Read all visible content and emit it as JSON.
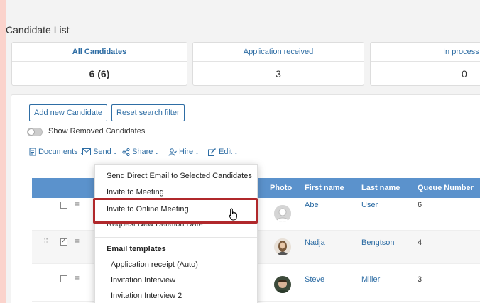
{
  "page": {
    "title": "Candidate List"
  },
  "stats": [
    {
      "label": "All Candidates",
      "value": "6 (6)",
      "active": true
    },
    {
      "label": "Application received",
      "value": "3",
      "active": false
    },
    {
      "label": "In process",
      "value": "0",
      "active": false
    }
  ],
  "actions": {
    "add_new": "Add new Candidate",
    "reset_filter": "Reset search filter",
    "show_removed": "Show Removed Candidates"
  },
  "toolbar": {
    "documents": "Documents",
    "send": "Send",
    "share": "Share",
    "hire": "Hire",
    "edit": "Edit"
  },
  "table": {
    "columns": [
      "Photo",
      "First name",
      "Last name",
      "Queue Number"
    ],
    "rows": [
      {
        "first": "Abe",
        "last": "User",
        "queue": "6",
        "checked": false
      },
      {
        "first": "Nadja",
        "last": "Bengtson",
        "queue": "4",
        "checked": true
      },
      {
        "first": "Steve",
        "last": "Miller",
        "queue": "3",
        "checked": false
      }
    ]
  },
  "send_menu": {
    "items": [
      "Send Direct Email to Selected Candidates",
      "Invite to Meeting",
      "Invite to Online Meeting",
      "Request New Deletion Date"
    ],
    "templates_header": "Email templates",
    "templates": [
      "Application receipt (Auto)",
      "Invitation Interview",
      "Invitation Interview 2"
    ]
  },
  "colors": {
    "accent": "#2e6da4",
    "grid_header": "#5b92cc",
    "highlight": "#b0282b",
    "outer_bg": "#fbd3cc"
  }
}
